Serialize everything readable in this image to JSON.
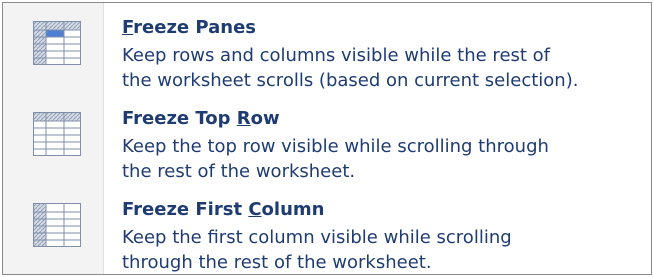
{
  "menu": {
    "items": [
      {
        "title_pre": "",
        "title_key": "F",
        "title_post": "reeze Panes",
        "desc_line1": "Keep rows and columns visible while the rest of",
        "desc_line2": "the worksheet scrolls (based on current selection).",
        "icon": "freeze-panes-icon"
      },
      {
        "title_pre": "Freeze Top ",
        "title_key": "R",
        "title_post": "ow",
        "desc_line1": "Keep the top row visible while scrolling through",
        "desc_line2": "the rest of the worksheet.",
        "icon": "freeze-top-row-icon"
      },
      {
        "title_pre": "Freeze First ",
        "title_key": "C",
        "title_post": "olumn",
        "desc_line1": "Keep the first column visible while scrolling",
        "desc_line2": "through the rest of the worksheet.",
        "icon": "freeze-first-column-icon"
      }
    ]
  },
  "colors": {
    "text": "#1e3c72",
    "gutter": "#f3f3f3",
    "border": "#8a8a8a",
    "grid_line": "#7f8fa9",
    "frozen_fill": "#c9d1de",
    "selection_fill": "#4f7fd4"
  }
}
